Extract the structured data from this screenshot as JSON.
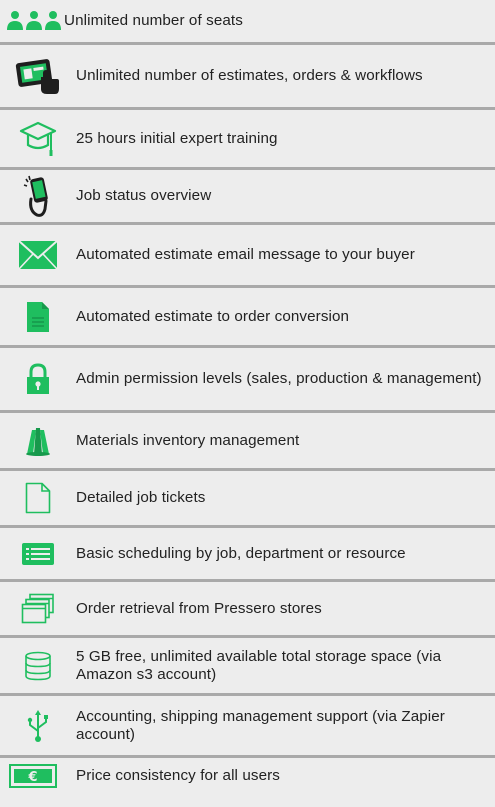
{
  "colors": {
    "accent_green": "#1fbe5f",
    "background": "#ededed",
    "divider": "#a9a9a9",
    "text": "#222222"
  },
  "features": [
    {
      "icon": "people-group-icon",
      "label": "Unlimited number of seats"
    },
    {
      "icon": "tablet-touch-icon",
      "label": "Unlimited number of estimates, orders & workflows"
    },
    {
      "icon": "graduation-cap-icon",
      "label": "25 hours initial expert training"
    },
    {
      "icon": "phone-hand-icon",
      "label": "Job status overview"
    },
    {
      "icon": "envelope-icon",
      "label": "Automated estimate email message to your buyer"
    },
    {
      "icon": "document-icon",
      "label": "Automated estimate to order conversion"
    },
    {
      "icon": "padlock-icon",
      "label": "Admin permission levels (sales, production & management)"
    },
    {
      "icon": "fabric-rolls-icon",
      "label": "Materials inventory management"
    },
    {
      "icon": "blank-page-icon",
      "label": "Detailed job tickets"
    },
    {
      "icon": "list-board-icon",
      "label": "Basic scheduling by job, department or resource"
    },
    {
      "icon": "stacked-windows-icon",
      "label": "Order retrieval from Pressero stores"
    },
    {
      "icon": "database-icon",
      "label": "5 GB free, unlimited available total storage space (via Amazon s3 account)"
    },
    {
      "icon": "usb-icon",
      "label": "Accounting, shipping management support (via Zapier account)"
    },
    {
      "icon": "euro-banknote-icon",
      "label": "Price consistency for all users"
    }
  ]
}
